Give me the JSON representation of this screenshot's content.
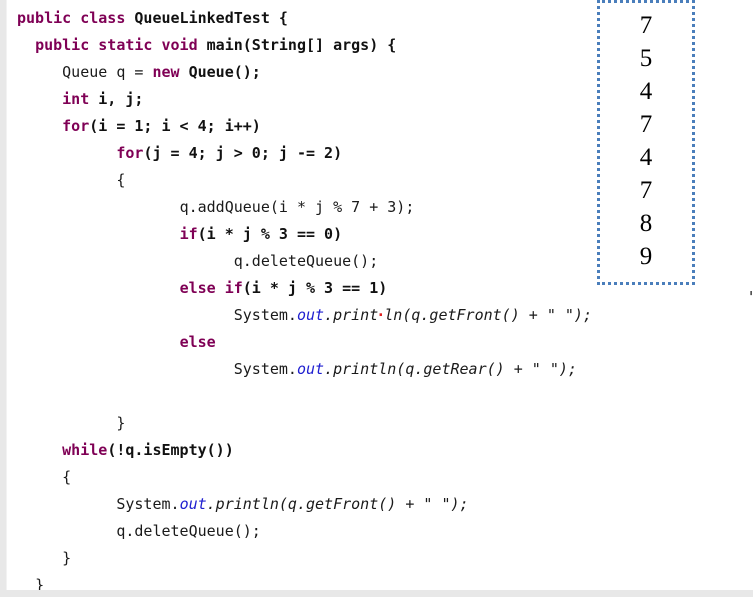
{
  "editor": {
    "language": "java",
    "colors": {
      "keyword": "#7f0055",
      "identifier": "#111111",
      "plain": "#1a1a1a",
      "field": "#2020d0",
      "caret": "#e02020",
      "gutter": "#e8e8e8",
      "background": "#ffffff",
      "output_border": "#4a7ebb"
    },
    "lines": [
      {
        "indent": "",
        "tokens": [
          {
            "t": "public",
            "c": "kw"
          },
          {
            "t": " ",
            "c": "pl"
          },
          {
            "t": "class",
            "c": "kw"
          },
          {
            "t": " ",
            "c": "pl"
          },
          {
            "t": "QueueLinkedTest {",
            "c": "id"
          }
        ]
      },
      {
        "indent": "  ",
        "tokens": [
          {
            "t": "public",
            "c": "kw"
          },
          {
            "t": " ",
            "c": "pl"
          },
          {
            "t": "static",
            "c": "kw"
          },
          {
            "t": " ",
            "c": "pl"
          },
          {
            "t": "void",
            "c": "kw"
          },
          {
            "t": " ",
            "c": "pl"
          },
          {
            "t": "main(String[] args) {",
            "c": "id"
          }
        ]
      },
      {
        "indent": "     ",
        "tokens": [
          {
            "t": "Queue q = ",
            "c": "pl"
          },
          {
            "t": "new",
            "c": "kw"
          },
          {
            "t": " ",
            "c": "pl"
          },
          {
            "t": "Queue();",
            "c": "id"
          }
        ]
      },
      {
        "indent": "     ",
        "tokens": [
          {
            "t": "int",
            "c": "kw"
          },
          {
            "t": " ",
            "c": "pl"
          },
          {
            "t": "i, j;",
            "c": "id"
          }
        ]
      },
      {
        "indent": "     ",
        "tokens": [
          {
            "t": "for",
            "c": "kw"
          },
          {
            "t": "(i = 1; i < 4; i++)",
            "c": "id"
          }
        ]
      },
      {
        "indent": "           ",
        "tokens": [
          {
            "t": "for",
            "c": "kw"
          },
          {
            "t": "(j = 4; j > 0; j -= 2)",
            "c": "id"
          }
        ]
      },
      {
        "indent": "           ",
        "tokens": [
          {
            "t": "{",
            "c": "pl"
          }
        ]
      },
      {
        "indent": "                  ",
        "tokens": [
          {
            "t": "q.addQueue(i * j % 7 + 3);",
            "c": "pl"
          }
        ]
      },
      {
        "indent": "                  ",
        "tokens": [
          {
            "t": "if",
            "c": "kw"
          },
          {
            "t": "(i * j % 3 == 0)",
            "c": "id"
          }
        ]
      },
      {
        "indent": "                        ",
        "tokens": [
          {
            "t": "q.deleteQueue();",
            "c": "pl"
          }
        ]
      },
      {
        "indent": "                  ",
        "tokens": [
          {
            "t": "else",
            "c": "kw"
          },
          {
            "t": " ",
            "c": "pl"
          },
          {
            "t": "if",
            "c": "kw"
          },
          {
            "t": "(i * j % 3 == 1)",
            "c": "id"
          }
        ]
      },
      {
        "indent": "                        ",
        "tokens": [
          {
            "t": "System.",
            "c": "pl"
          },
          {
            "t": "out",
            "c": "fld"
          },
          {
            "t": ".print",
            "c": "it"
          },
          {
            "t": "·",
            "c": "caret"
          },
          {
            "t": "ln(q.getFront() + \" \");",
            "c": "it"
          }
        ]
      },
      {
        "indent": "                  ",
        "tokens": [
          {
            "t": "else",
            "c": "kw"
          }
        ]
      },
      {
        "indent": "                        ",
        "tokens": [
          {
            "t": "System.",
            "c": "pl"
          },
          {
            "t": "out",
            "c": "fld"
          },
          {
            "t": ".println(q.getRear() + \" \");",
            "c": "it"
          }
        ]
      },
      {
        "indent": "",
        "tokens": []
      },
      {
        "indent": "           ",
        "tokens": [
          {
            "t": "}",
            "c": "pl"
          }
        ]
      },
      {
        "indent": "     ",
        "tokens": [
          {
            "t": "while",
            "c": "kw"
          },
          {
            "t": "(!q.isEmpty())",
            "c": "id"
          }
        ]
      },
      {
        "indent": "     ",
        "tokens": [
          {
            "t": "{",
            "c": "pl"
          }
        ]
      },
      {
        "indent": "           ",
        "tokens": [
          {
            "t": "System.",
            "c": "pl"
          },
          {
            "t": "out",
            "c": "fld"
          },
          {
            "t": ".println(q.getFront() + \" \");",
            "c": "it"
          }
        ]
      },
      {
        "indent": "           ",
        "tokens": [
          {
            "t": "q.deleteQueue();",
            "c": "pl"
          }
        ]
      },
      {
        "indent": "     ",
        "tokens": [
          {
            "t": "}",
            "c": "pl"
          }
        ]
      },
      {
        "indent": "  ",
        "tokens": [
          {
            "t": "}",
            "c": "pl"
          }
        ]
      }
    ]
  },
  "output": {
    "label": "console-output",
    "values": [
      "7",
      "5",
      "4",
      "7",
      "4",
      "7",
      "8",
      "9"
    ]
  },
  "edge_clip": {
    "text": "\""
  }
}
